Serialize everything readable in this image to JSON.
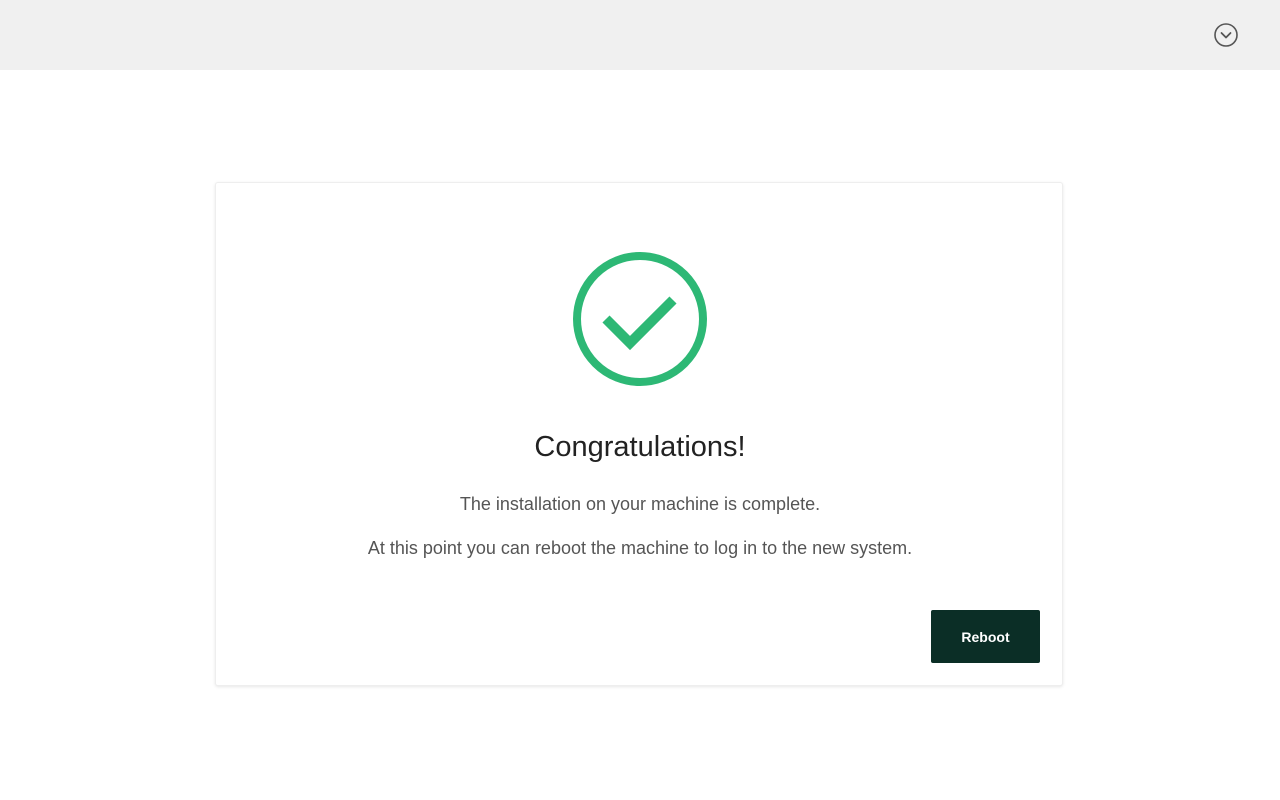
{
  "header": {
    "menu_icon": "chevron-down-circle-icon"
  },
  "completion": {
    "status_icon": "check-circle-icon",
    "status_color": "#2db875",
    "title": "Congratulations!",
    "message_line1": "The installation on your machine is complete.",
    "message_line2": "At this point you can reboot the machine to log in to the new system.",
    "reboot_label": "Reboot",
    "button_color": "#0b2e26"
  }
}
